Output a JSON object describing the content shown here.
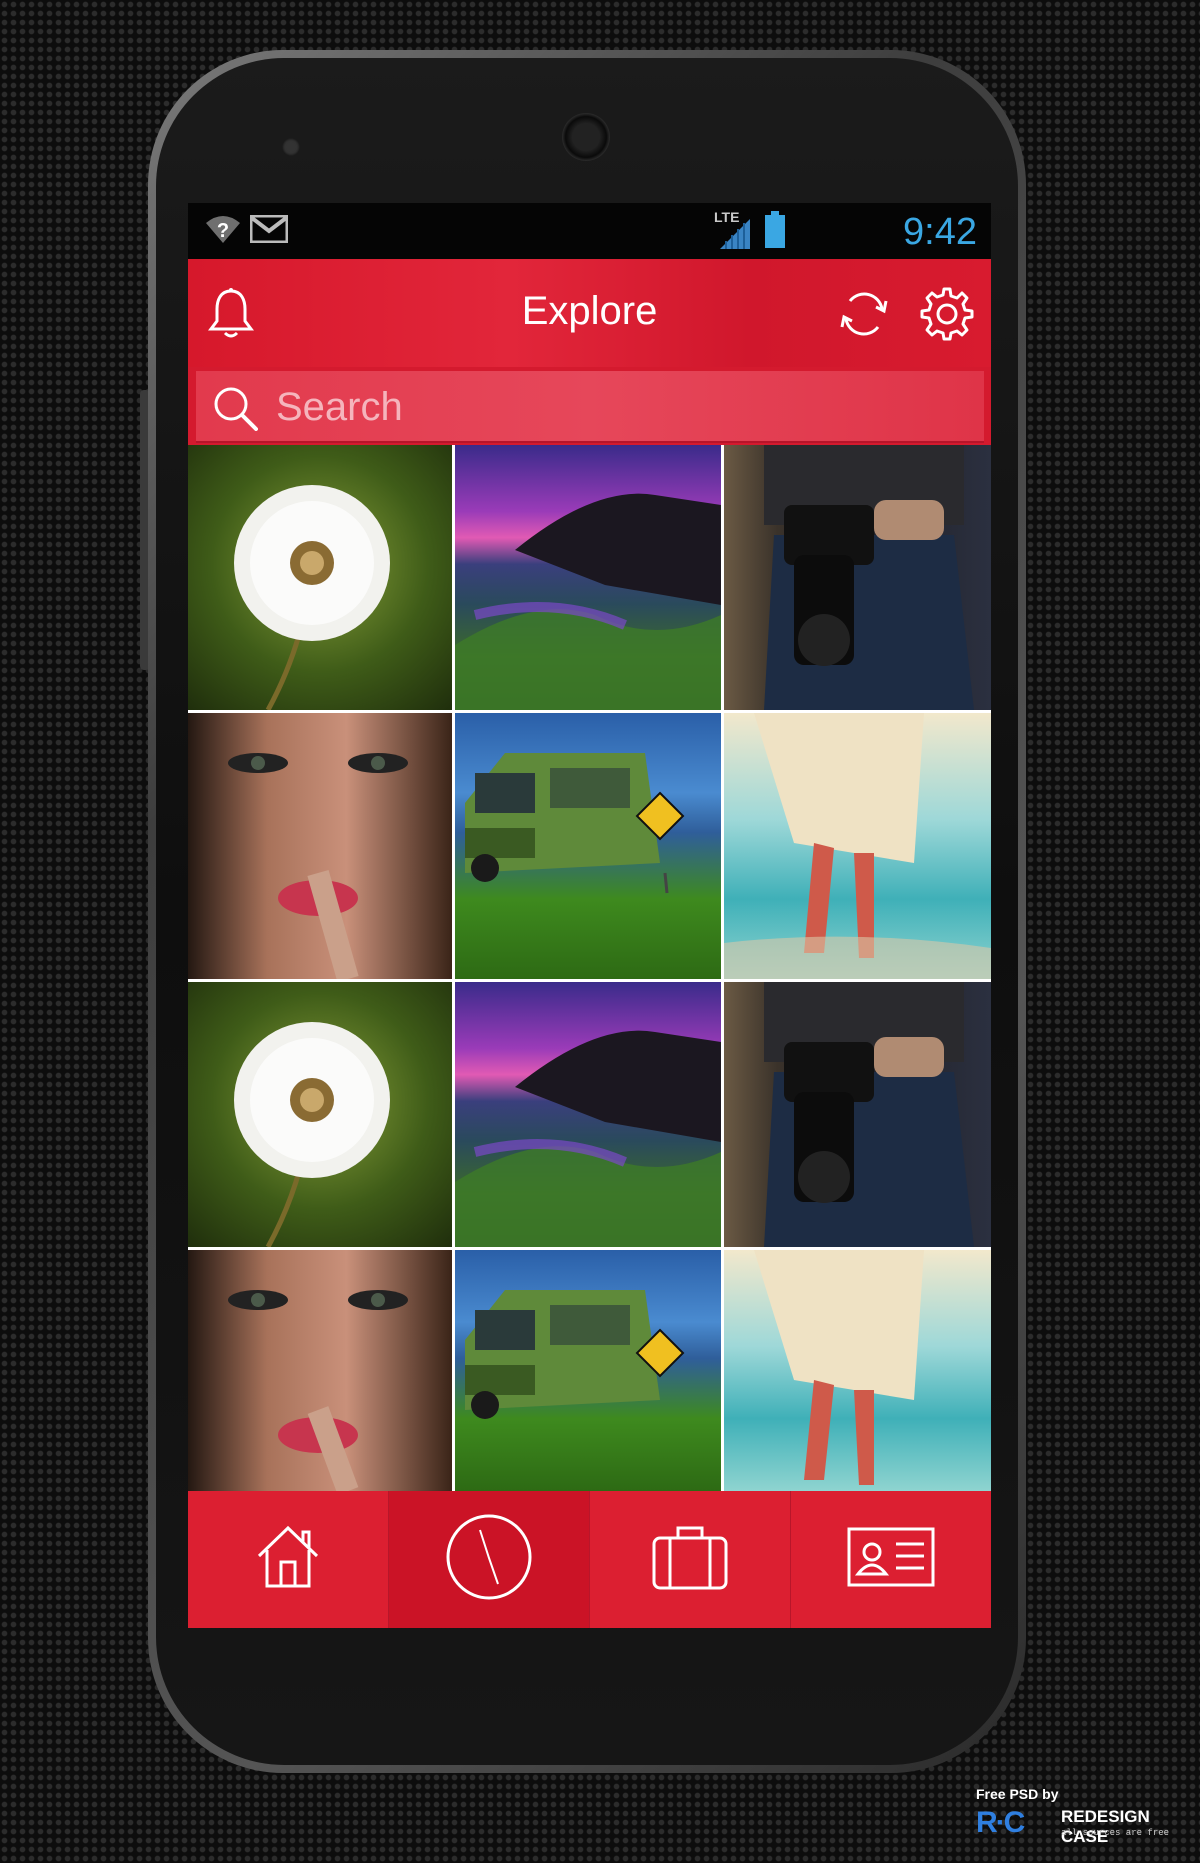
{
  "status_bar": {
    "network": "LTE",
    "time": "9:42"
  },
  "app_bar": {
    "title": "Explore"
  },
  "search": {
    "placeholder": "Search"
  },
  "gallery": {
    "tiles": [
      {
        "subject": "dandelion"
      },
      {
        "subject": "purple-sunset-coast"
      },
      {
        "subject": "woman-with-camera"
      },
      {
        "subject": "woman-portrait"
      },
      {
        "subject": "green-van"
      },
      {
        "subject": "walking-on-beach"
      },
      {
        "subject": "dandelion"
      },
      {
        "subject": "purple-sunset-coast"
      },
      {
        "subject": "woman-with-camera"
      },
      {
        "subject": "woman-portrait"
      },
      {
        "subject": "green-van"
      },
      {
        "subject": "walking-on-beach"
      }
    ]
  },
  "bottom_nav": {
    "items": [
      {
        "icon": "home-icon"
      },
      {
        "icon": "compass-icon",
        "active": true
      },
      {
        "icon": "briefcase-icon"
      },
      {
        "icon": "id-card-icon"
      }
    ]
  },
  "credit": {
    "top": "Free PSD by",
    "logo": "R·C",
    "name": "REDESIGN CASE",
    "tagline": "all sources are free"
  },
  "colors": {
    "accent_red": "#dc1f31",
    "clock_blue": "#3aa7e3"
  }
}
